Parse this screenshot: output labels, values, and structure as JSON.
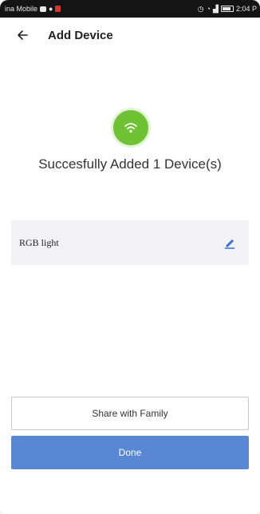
{
  "status_bar": {
    "carrier": "ina Mobile",
    "time": "2:04 P"
  },
  "header": {
    "title": "Add Device"
  },
  "success": {
    "message": "Succesfully Added 1 Device(s)"
  },
  "devices": [
    {
      "name": "RGB light"
    }
  ],
  "actions": {
    "share_label": "Share with Family",
    "done_label": "Done"
  },
  "colors": {
    "success_green": "#6fc234",
    "primary_blue": "#5a87d4",
    "edit_icon_blue": "#2f6fd6"
  },
  "icons": {
    "back": "arrow-left-icon",
    "success": "wifi-icon",
    "edit": "pencil-icon"
  }
}
